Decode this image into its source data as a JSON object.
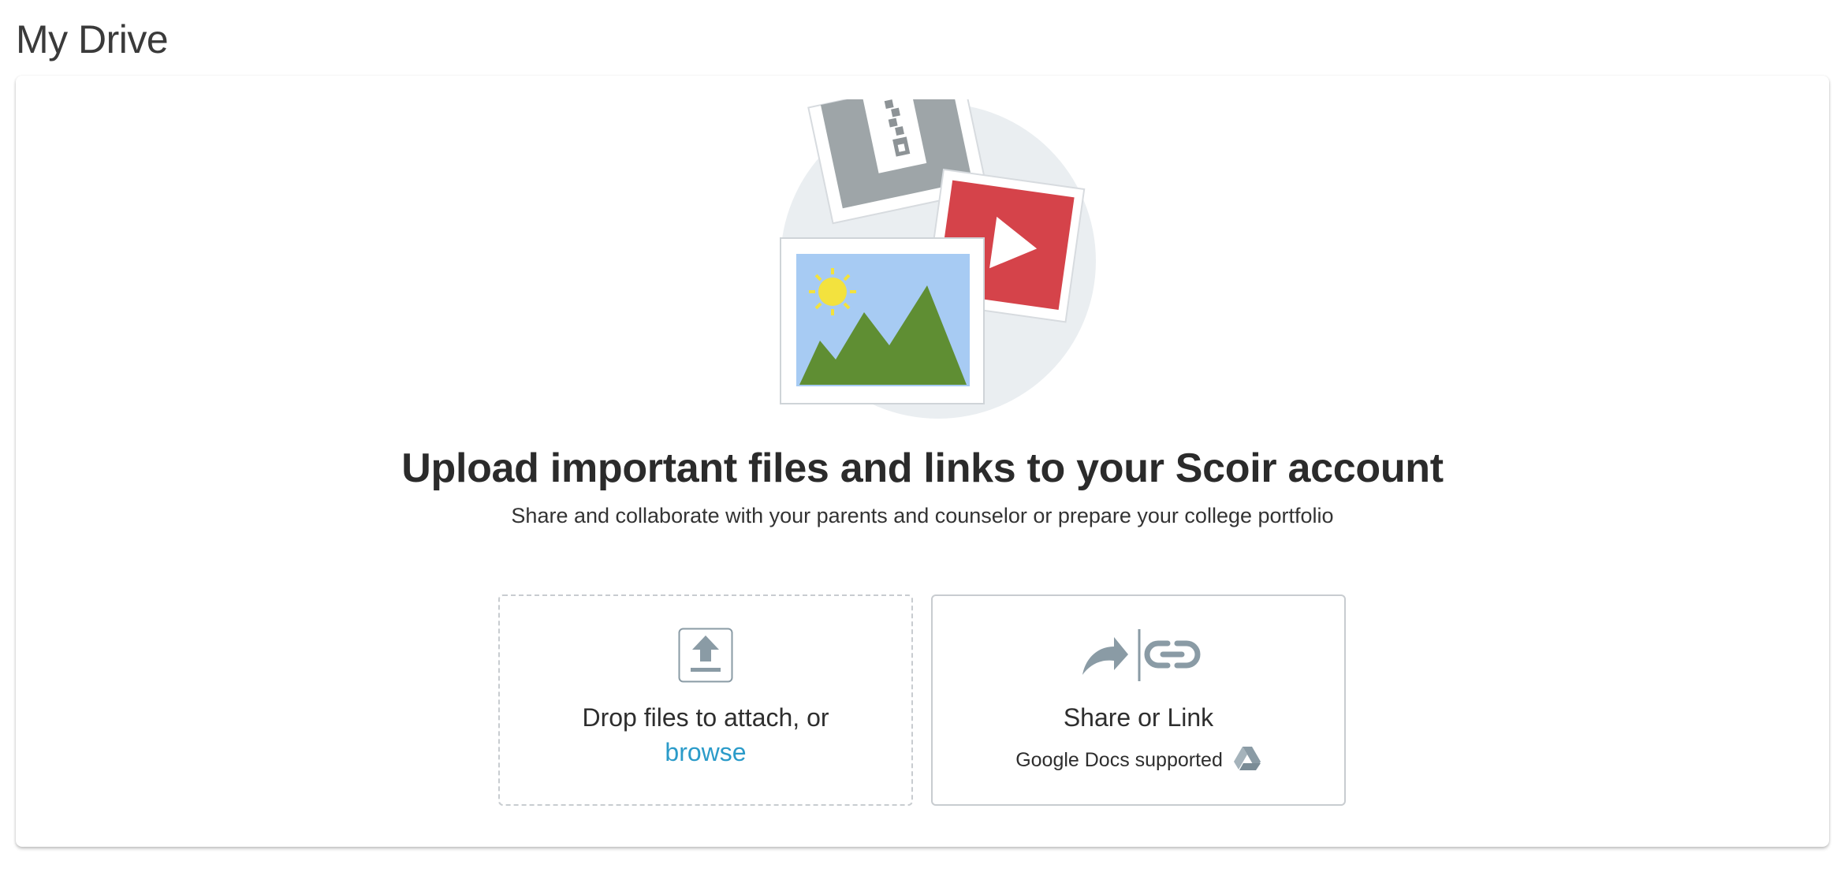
{
  "page": {
    "title": "My Drive"
  },
  "empty_state": {
    "headline": "Upload important files and links to your Scoir account",
    "subheadline": "Share and collaborate with your parents and counselor or prepare your college portfolio"
  },
  "upload_option": {
    "label": "Drop files to attach, or",
    "browse_label": "browse",
    "icon": "upload-icon"
  },
  "link_option": {
    "label": "Share or Link",
    "note": "Google Docs supported",
    "icons": [
      "share-arrow-icon",
      "link-icon",
      "google-drive-icon"
    ]
  },
  "colors": {
    "link": "#2b9bc9",
    "icon_gray": "#8a9ba5",
    "border": "#c8ccd0",
    "hero_circle": "#eaeef1",
    "video_red": "#d5434a",
    "sky_blue": "#a7cbf3",
    "mountain_green": "#5f8e33",
    "sun_yellow": "#f3e23e"
  }
}
